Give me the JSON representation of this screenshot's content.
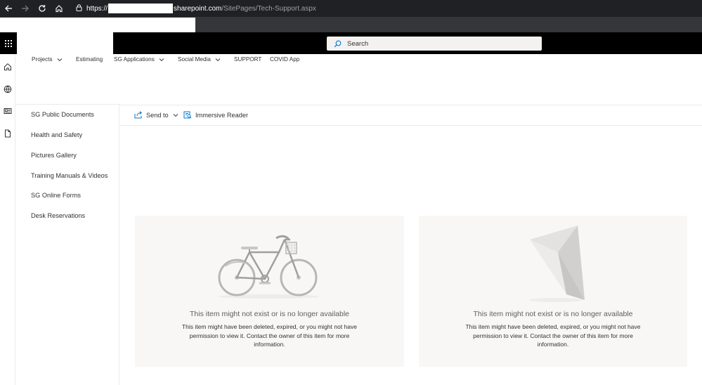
{
  "browser": {
    "url_scheme": "https://",
    "url_host": "sharepoint.com",
    "url_path": "/SitePages/Tech-Support.aspx"
  },
  "suite_bar": {
    "search_placeholder": "Search"
  },
  "top_nav": {
    "items": [
      {
        "label": "Projects",
        "has_dropdown": true
      },
      {
        "label": "Estimating",
        "has_dropdown": false
      },
      {
        "label": "SG Applications",
        "has_dropdown": true
      },
      {
        "label": "Social Media",
        "has_dropdown": true
      },
      {
        "label": "SUPPORT",
        "has_dropdown": false
      },
      {
        "label": "COVID App",
        "has_dropdown": false
      }
    ]
  },
  "left_nav": {
    "items": [
      "SG Public Documents",
      "Health and Safety",
      "Pictures Gallery",
      "Training Manuals & Videos",
      "SG Online Forms",
      "Desk Reservations"
    ]
  },
  "command_bar": {
    "send_to": "Send to",
    "immersive_reader": "Immersive Reader"
  },
  "cards": [
    {
      "title": "This item might not exist or is no longer available",
      "description": "This item might have been deleted, expired, or you might not have permission to view it. Contact the owner of this item for more information."
    },
    {
      "title": "This item might not exist or is no longer available",
      "description": "This item might have been deleted, expired, or you might not have permission to view it. Contact the owner of this item for more information."
    }
  ],
  "icons": {
    "back": "arrow-left-icon",
    "forward": "arrow-right-icon",
    "reload": "reload-icon",
    "home": "home-icon",
    "lock": "lock-icon",
    "waffle": "app-launcher-icon",
    "search": "search-icon",
    "rail": [
      "home-icon",
      "globe-icon",
      "news-icon",
      "document-icon"
    ],
    "send_to": "share-icon",
    "immersive_reader": "immersive-reader-icon"
  }
}
